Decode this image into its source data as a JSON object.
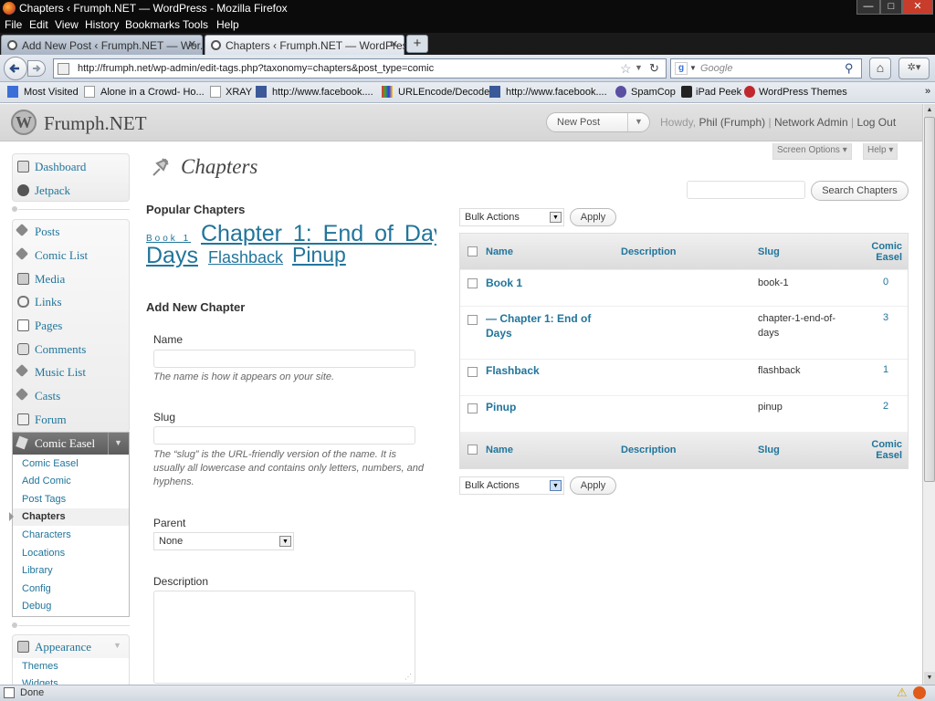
{
  "window": {
    "title": "Chapters ‹ Frumph.NET — WordPress - Mozilla Firefox",
    "min": "—",
    "max": "□",
    "close": "✕"
  },
  "menubar": [
    "File",
    "Edit",
    "View",
    "History",
    "Bookmarks",
    "Tools",
    "Help"
  ],
  "tabs": [
    {
      "label": "Add New Post ‹ Frumph.NET — Wor...",
      "close": "✕"
    },
    {
      "label": "Chapters ‹ Frumph.NET — WordPress",
      "close": "✕"
    }
  ],
  "newtab": "+",
  "nav": {
    "url": "http://frumph.net/wp-admin/edit-tags.php?taxonomy=chapters&post_type=comic",
    "search_placeholder": "Google"
  },
  "bookmarks": [
    "Most Visited",
    "Alone in a Crowd- Ho...",
    "XRAY",
    "http://www.facebook....",
    "URLEncode/Decode",
    "http://www.facebook....",
    "SpamCop",
    "iPad Peek",
    "WordPress Themes"
  ],
  "wp": {
    "site": "Frumph.NET",
    "new_post": "New Post",
    "howdy": "Howdy,",
    "user": "Phil (Frumph)",
    "network_admin": "Network Admin",
    "log_out": "Log Out",
    "screen_options": "Screen Options ▾",
    "help": "Help ▾"
  },
  "sidebar": {
    "top": [
      "Dashboard",
      "Jetpack"
    ],
    "main": [
      "Posts",
      "Comic List",
      "Media",
      "Links",
      "Pages",
      "Comments",
      "Music List",
      "Casts",
      "Forum"
    ],
    "comic_easel": "Comic Easel",
    "comic_sub": [
      "Comic Easel",
      "Add Comic",
      "Post Tags",
      "Chapters",
      "Characters",
      "Locations",
      "Library",
      "Config",
      "Debug"
    ],
    "appearance": "Appearance",
    "appearance_sub": [
      "Themes",
      "Widgets"
    ]
  },
  "page": {
    "title": "Chapters",
    "popular_title": "Popular Chapters",
    "cloud": [
      "Book 1",
      "Chapter 1: End of Days",
      "Flashback",
      "Pinup"
    ],
    "add_title": "Add New Chapter",
    "name_label": "Name",
    "name_hint": "The name is how it appears on your site.",
    "slug_label": "Slug",
    "slug_hint": "The “slug” is the URL-friendly version of the name. It is usually all lowercase and contains only letters, numbers, and hyphens.",
    "parent_label": "Parent",
    "parent_value": "None",
    "desc_label": "Description",
    "search_button": "Search Chapters",
    "bulk_actions": "Bulk Actions",
    "apply": "Apply"
  },
  "table": {
    "headers": {
      "name": "Name",
      "description": "Description",
      "slug": "Slug",
      "count": "Comic Easel"
    },
    "rows": [
      {
        "name": "Book 1",
        "slug": "book-1",
        "count": "0"
      },
      {
        "name": "— Chapter 1: End of Days",
        "slug": "chapter-1-end-of-days",
        "count": "3"
      },
      {
        "name": "Flashback",
        "slug": "flashback",
        "count": "1"
      },
      {
        "name": "Pinup",
        "slug": "pinup",
        "count": "2"
      }
    ]
  },
  "status": {
    "text": "Done"
  }
}
